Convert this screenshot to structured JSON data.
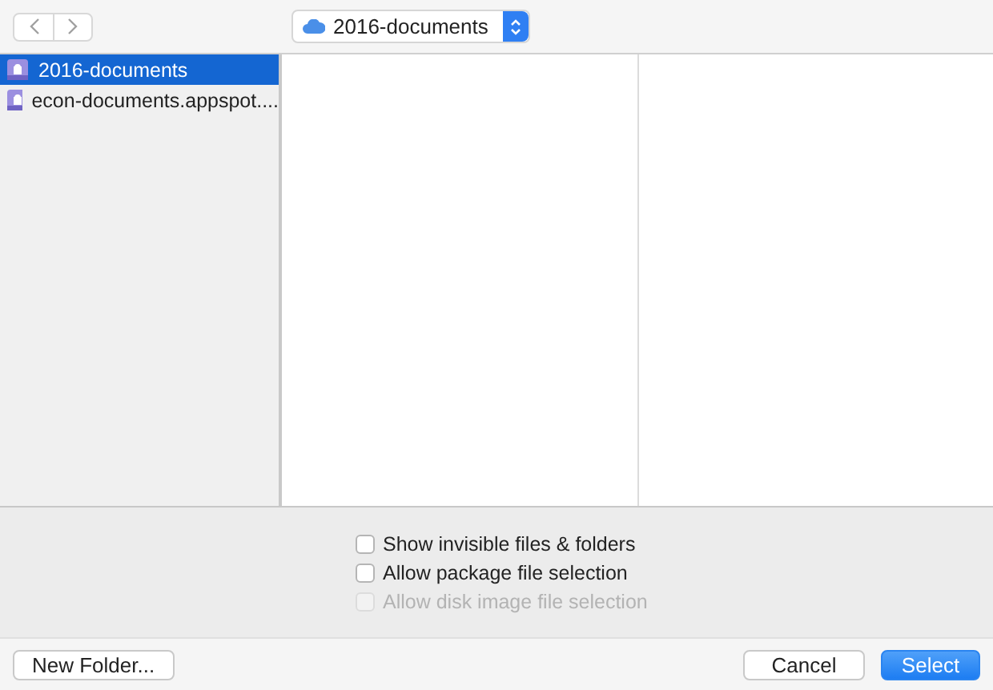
{
  "location": {
    "label": "2016-documents"
  },
  "sidebar": {
    "items": [
      {
        "label": "2016-documents",
        "selected": true
      },
      {
        "label": "econ-documents.appspot....",
        "selected": false
      }
    ]
  },
  "options": [
    {
      "label": "Show invisible files & folders",
      "checked": false,
      "disabled": false
    },
    {
      "label": "Allow package file selection",
      "checked": false,
      "disabled": false
    },
    {
      "label": "Allow disk image file selection",
      "checked": false,
      "disabled": true
    }
  ],
  "footer": {
    "left": [
      {
        "label": "New Folder...",
        "kind": "normal"
      }
    ],
    "right": [
      {
        "label": "Cancel",
        "kind": "normal"
      },
      {
        "label": "Select",
        "kind": "default"
      }
    ]
  }
}
